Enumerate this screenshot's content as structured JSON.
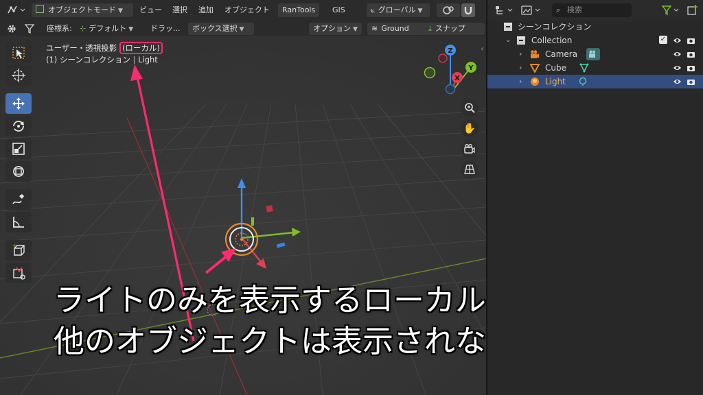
{
  "header": {
    "mode_label": "オブジェクトモード",
    "menu": [
      "ビュー",
      "選択",
      "追加",
      "オブジェクト"
    ],
    "addon_rantools": "RanTools",
    "addon_gis": "GIS",
    "orientation_label": "グローバル"
  },
  "toolbar2": {
    "coord_label": "座標系:",
    "coord_value": "デフォルト",
    "drag_label": "ドラッ...",
    "select_mode": "ボックス選択",
    "options_label": "オプション",
    "ground_label": "Ground",
    "snap_label": "スナップ"
  },
  "viewport": {
    "view_name": "ユーザー・透視投影",
    "local_tag": "(ローカル)",
    "scene_info": "(1) シーンコレクション",
    "active_object": "Light",
    "gizmo_axes": {
      "z": "Z",
      "y": "Y",
      "x": "X"
    }
  },
  "caption": {
    "line1": "ライトのみを表示するローカルビュー。",
    "line2": "他のオブジェクトは表示されない。"
  },
  "outliner": {
    "search_placeholder": "検索",
    "scene_collection": "シーンコレクション",
    "collection": "Collection",
    "items": [
      {
        "label": "Camera",
        "icon": "camera-icon",
        "selected": false
      },
      {
        "label": "Cube",
        "icon": "mesh-icon",
        "selected": false
      },
      {
        "label": "Light",
        "icon": "light-icon",
        "selected": true
      }
    ]
  },
  "colors": {
    "annotation": "#ff2a70",
    "selection": "#334d80",
    "active_tool": "#4772b3",
    "x_axis": "#e04050",
    "y_axis": "#7fbf2a",
    "z_axis": "#3f8ff0"
  }
}
